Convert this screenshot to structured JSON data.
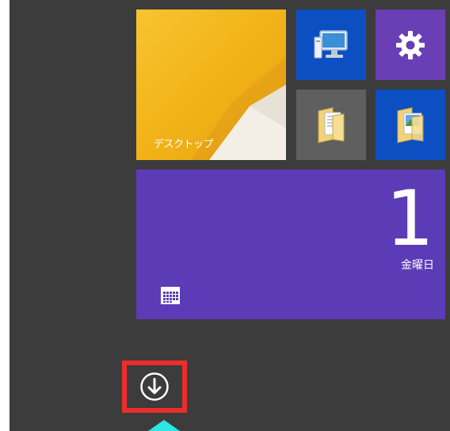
{
  "tiles": {
    "desktop": {
      "label": "デスクトップ",
      "color": "#f2b41a"
    },
    "computer": {
      "icon": "computer-icon",
      "color": "#0b4fc3"
    },
    "settings": {
      "icon": "gear-icon",
      "color": "#6a3fb6"
    },
    "documents": {
      "icon": "folder-documents-icon",
      "color": "#5f5f5f"
    },
    "pictures": {
      "icon": "folder-pictures-icon",
      "color": "#0b4fc3"
    },
    "calendar": {
      "day": "1",
      "weekday": "金曜日",
      "icon": "calendar-icon",
      "color": "#5b3cb6"
    }
  },
  "all_apps": {
    "icon": "down-arrow-circle-icon",
    "highlight_color": "#ee2c2c"
  },
  "annotation": {
    "icon": "pointer-arrow-icon",
    "color": "#2ee6e6"
  },
  "colors": {
    "start_background": "#3c3c3c"
  }
}
